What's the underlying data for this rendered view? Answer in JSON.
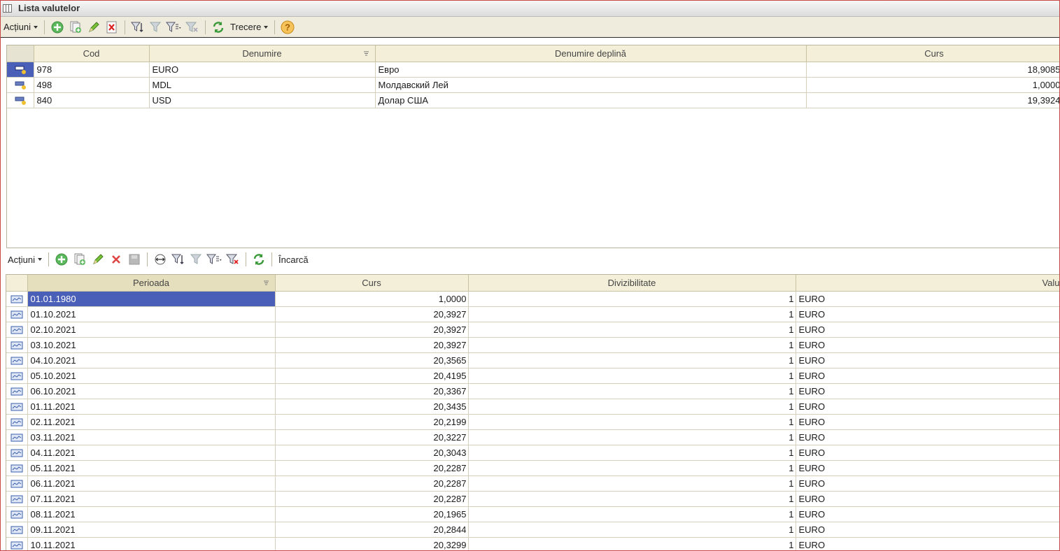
{
  "window": {
    "title": "Lista valutelor"
  },
  "toolbar1": {
    "actions_label": "Acțiuni",
    "trecere_label": "Trecere"
  },
  "currencies": {
    "columns": [
      "Cod",
      "Denumire",
      "Denumire deplină",
      "Curs"
    ],
    "rows": [
      {
        "cod": "978",
        "denumire": "EURO",
        "denumire_deplina": "Евро",
        "curs": "18,9085"
      },
      {
        "cod": "498",
        "denumire": "MDL",
        "denumire_deplina": "Молдавский Лей",
        "curs": "1,0000"
      },
      {
        "cod": "840",
        "denumire": "USD",
        "denumire_deplina": "Долар США",
        "curs": "19,3924"
      }
    ]
  },
  "toolbar2": {
    "actions_label": "Acțiuni",
    "incarca_label": "Încarcă"
  },
  "rates": {
    "columns": [
      "Perioada",
      "Curs",
      "Divizibilitate",
      "Valu"
    ],
    "rows": [
      {
        "perioada": "01.01.1980",
        "curs": "1,0000",
        "div": "1",
        "valuta": "EURO"
      },
      {
        "perioada": "01.10.2021",
        "curs": "20,3927",
        "div": "1",
        "valuta": "EURO"
      },
      {
        "perioada": "02.10.2021",
        "curs": "20,3927",
        "div": "1",
        "valuta": "EURO"
      },
      {
        "perioada": "03.10.2021",
        "curs": "20,3927",
        "div": "1",
        "valuta": "EURO"
      },
      {
        "perioada": "04.10.2021",
        "curs": "20,3565",
        "div": "1",
        "valuta": "EURO"
      },
      {
        "perioada": "05.10.2021",
        "curs": "20,4195",
        "div": "1",
        "valuta": "EURO"
      },
      {
        "perioada": "06.10.2021",
        "curs": "20,3367",
        "div": "1",
        "valuta": "EURO"
      },
      {
        "perioada": "01.11.2021",
        "curs": "20,3435",
        "div": "1",
        "valuta": "EURO"
      },
      {
        "perioada": "02.11.2021",
        "curs": "20,2199",
        "div": "1",
        "valuta": "EURO"
      },
      {
        "perioada": "03.11.2021",
        "curs": "20,3227",
        "div": "1",
        "valuta": "EURO"
      },
      {
        "perioada": "04.11.2021",
        "curs": "20,3043",
        "div": "1",
        "valuta": "EURO"
      },
      {
        "perioada": "05.11.2021",
        "curs": "20,2287",
        "div": "1",
        "valuta": "EURO"
      },
      {
        "perioada": "06.11.2021",
        "curs": "20,2287",
        "div": "1",
        "valuta": "EURO"
      },
      {
        "perioada": "07.11.2021",
        "curs": "20,2287",
        "div": "1",
        "valuta": "EURO"
      },
      {
        "perioada": "08.11.2021",
        "curs": "20,1965",
        "div": "1",
        "valuta": "EURO"
      },
      {
        "perioada": "09.11.2021",
        "curs": "20,2844",
        "div": "1",
        "valuta": "EURO"
      },
      {
        "perioada": "10.11.2021",
        "curs": "20,3299",
        "div": "1",
        "valuta": "EURO"
      }
    ]
  },
  "colors": {
    "selection": "#4a5fb8",
    "header": "#f3efd9",
    "toolbar": "#efebdd"
  }
}
